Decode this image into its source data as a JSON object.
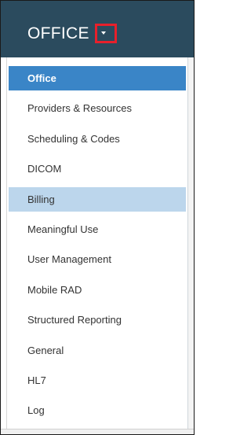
{
  "header": {
    "title": "OFFICE",
    "background_color": "#2b4b5e",
    "dropdown_icon": "caret-down-icon",
    "highlight_box_color": "#e8202b"
  },
  "menu": {
    "active_color": "#3a85c7",
    "hover_color": "#bcd6ec",
    "items": [
      {
        "label": "Office",
        "state": "active"
      },
      {
        "label": "Providers & Resources",
        "state": "normal"
      },
      {
        "label": "Scheduling & Codes",
        "state": "normal"
      },
      {
        "label": "DICOM",
        "state": "normal"
      },
      {
        "label": "Billing",
        "state": "highlight"
      },
      {
        "label": "Meaningful Use",
        "state": "normal"
      },
      {
        "label": "User Management",
        "state": "normal"
      },
      {
        "label": "Mobile RAD",
        "state": "normal"
      },
      {
        "label": "Structured Reporting",
        "state": "normal"
      },
      {
        "label": "General",
        "state": "normal"
      },
      {
        "label": "HL7",
        "state": "normal"
      },
      {
        "label": "Log",
        "state": "normal"
      }
    ]
  }
}
